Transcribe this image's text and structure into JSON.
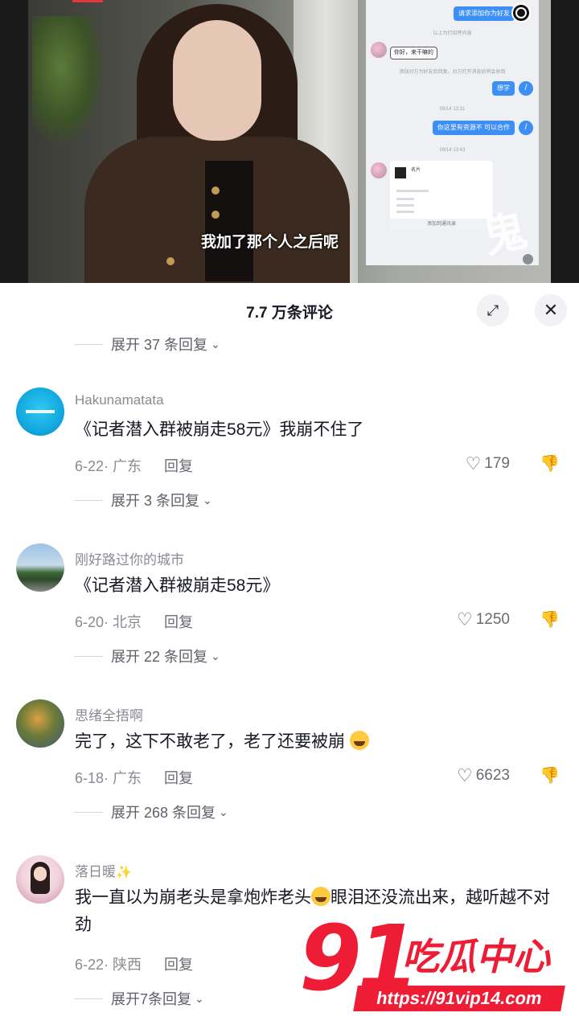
{
  "video": {
    "subtitle": "我加了那个人之后呢",
    "chat_screenshot": {
      "bubble1": "请求添加你为好友",
      "sys1": "以上为打招呼内容",
      "incoming1": "你好，来干嘛的",
      "sys2": "添加对方为好友后回复，对方打开消息后将会收到",
      "bubble2": "想学",
      "time1": "09/14 13:31",
      "bubble3": "你这里有资源不 可以合作",
      "time2": "09/14 13:43",
      "card_title": "名片",
      "card_footer": "添加到通讯录"
    }
  },
  "sheet": {
    "title": "7.7 万条评论",
    "expand_icon": "expand-icon",
    "close_icon": "close-icon"
  },
  "replies_top": "展开 37 条回复",
  "comments": [
    {
      "username": "Hakunamatata",
      "text": "《记者潜入群被崩走58元》我崩不住了",
      "date_loc": "6-22· 广东",
      "reply": "回复",
      "likes": "179",
      "expand": "展开 3 条回复"
    },
    {
      "username": "刚好路过你的城市",
      "text": "《记者潜入群被崩走58元》",
      "date_loc": "6-20· 北京",
      "reply": "回复",
      "likes": "1250",
      "expand": "展开 22 条回复"
    },
    {
      "username": "思绪全捂啊",
      "text": "完了，这下不敢老了，老了还要被崩",
      "date_loc": "6-18· 广东",
      "reply": "回复",
      "likes": "6623",
      "expand": "展开 268 条回复"
    },
    {
      "username": "落日暖",
      "text_part1": "我一直以为崩老头是拿炮炸老头",
      "text_part2": "眼泪还没流出来，越听越不对劲",
      "date_loc": "6-22· 陕西",
      "reply": "回复",
      "expand": "展开7条回复"
    }
  ],
  "watermark": {
    "number": "91",
    "name": "吃瓜中心",
    "url": "https://91vip14.com"
  }
}
